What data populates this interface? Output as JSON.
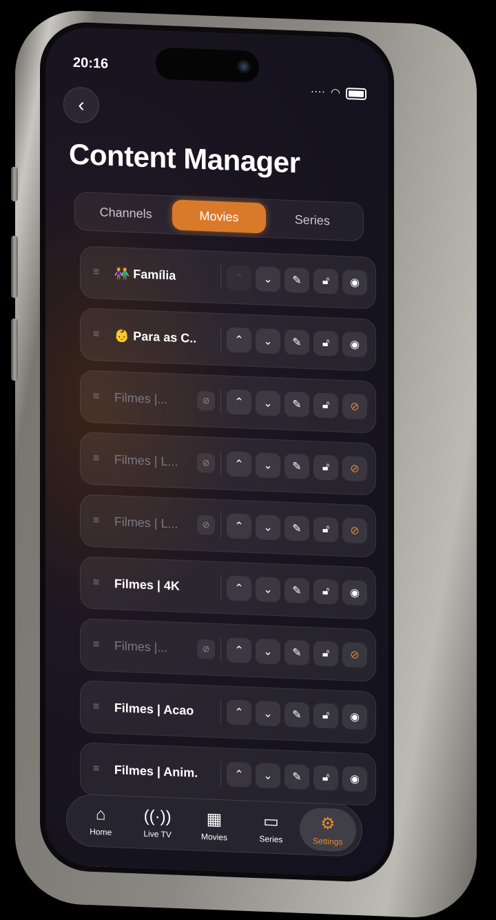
{
  "status": {
    "time": "20:16",
    "signal_icon": "signal-dots-icon",
    "wifi_icon": "wifi-icon",
    "battery_icon": "battery-icon"
  },
  "header": {
    "back_icon": "chevron-left-icon",
    "title": "Content Manager"
  },
  "segments": {
    "tabs": [
      {
        "label": "Channels"
      },
      {
        "label": "Movies"
      },
      {
        "label": "Series"
      }
    ],
    "selected": "Movies"
  },
  "rows": [
    {
      "name": "👫 Família",
      "hidden": false
    },
    {
      "name": "👶 Para as C...",
      "hidden": false
    },
    {
      "name": "Filmes |...",
      "hidden": true
    },
    {
      "name": "Filmes | L...",
      "hidden": true
    },
    {
      "name": "Filmes | L...",
      "hidden": true
    },
    {
      "name": "Filmes | 4K",
      "hidden": false
    },
    {
      "name": "Filmes |...",
      "hidden": true
    },
    {
      "name": "Filmes | Acao",
      "hidden": false
    },
    {
      "name": "Filmes | Anim...",
      "hidden": false
    }
  ],
  "tabbar": {
    "items": [
      {
        "label": "Home",
        "icon": "home-icon"
      },
      {
        "label": "Live TV",
        "icon": "antenna-icon"
      },
      {
        "label": "Movies",
        "icon": "film-icon"
      },
      {
        "label": "Series",
        "icon": "tv-icon"
      },
      {
        "label": "Settings",
        "icon": "gear-icon"
      }
    ],
    "selected": "Settings"
  },
  "colors": {
    "accent": "#d97a2b"
  }
}
